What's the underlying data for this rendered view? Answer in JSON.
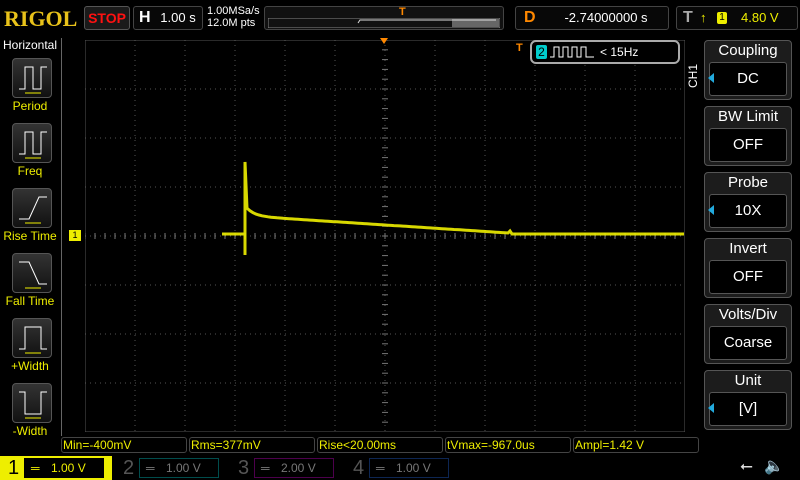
{
  "header": {
    "logo": "RIGOL",
    "run_state": "STOP",
    "h_label": "H",
    "timebase": "1.00 s",
    "sample_rate": "1.00MSa/s",
    "memory_depth": "12.0M pts",
    "trigger_marker": "T",
    "delay_label": "D",
    "delay": "-2.74000000 s",
    "trigger_label": "T",
    "trigger_source": "1",
    "trigger_level": "4.80 V"
  },
  "left_menu": {
    "title": "Horizontal",
    "items": [
      {
        "label": "Period"
      },
      {
        "label": "Freq"
      },
      {
        "label": "Rise Time"
      },
      {
        "label": "Fall Time"
      },
      {
        "label": "+Width"
      },
      {
        "label": "-Width"
      }
    ]
  },
  "screen": {
    "ch1_marker": "1",
    "ch2_badge": "2",
    "ch2_freq": "< 15Hz",
    "trace_color": "#f0f000"
  },
  "right_menu": {
    "channel": "CH1",
    "items": [
      {
        "title": "Coupling",
        "value": "DC"
      },
      {
        "title": "BW Limit",
        "value": "OFF"
      },
      {
        "title": "Probe",
        "value": "10X"
      },
      {
        "title": "Invert",
        "value": "OFF"
      },
      {
        "title": "Volts/Div",
        "value": "Coarse"
      },
      {
        "title": "Unit",
        "value": "[V]"
      }
    ]
  },
  "measurements": [
    "Min=-400mV",
    "Rms=377mV",
    "Rise<20.00ms",
    "tVmax=-967.0us",
    "Ampl=1.42 V"
  ],
  "channels": [
    {
      "num": "1",
      "scale": "1.00 V",
      "color": "#f0f000"
    },
    {
      "num": "2",
      "scale": "1.00 V",
      "color": "#00c0c0"
    },
    {
      "num": "3",
      "scale": "2.00 V",
      "color": "#c000c0"
    },
    {
      "num": "4",
      "scale": "1.00 V",
      "color": "#2060d0"
    }
  ]
}
